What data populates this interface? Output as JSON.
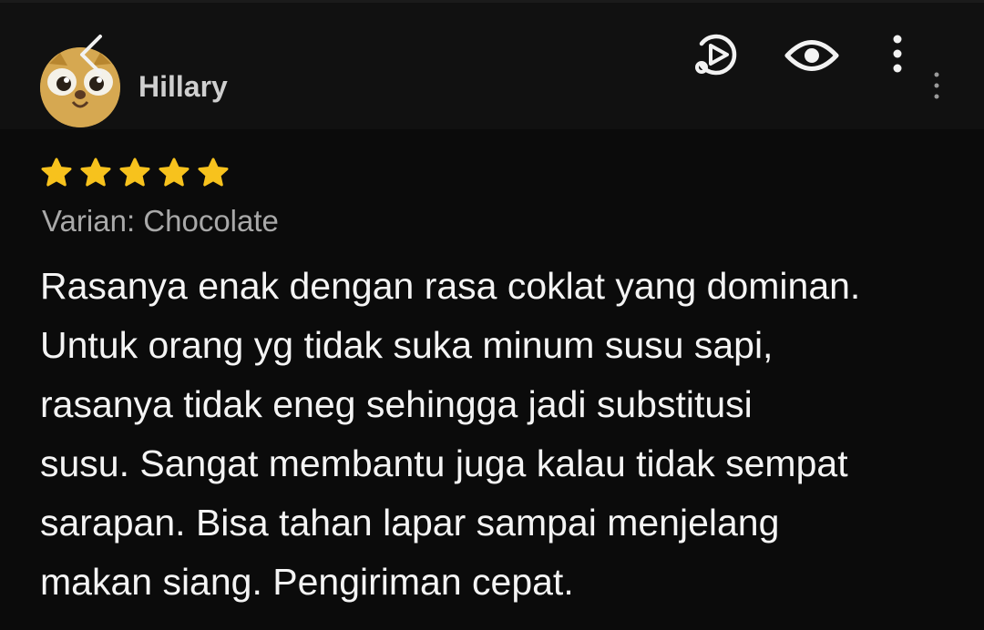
{
  "header": {
    "username": "Hillary",
    "icons": [
      "back-icon",
      "video-play-icon",
      "eye-icon",
      "more-vertical-icon"
    ]
  },
  "review": {
    "rating": 5,
    "rating_max": 5,
    "variant": "Varian: Chocolate",
    "lines": [
      "Rasanya enak dengan rasa coklat yang dominan.",
      "Untuk orang yg tidak suka minum susu sapi,",
      "rasanya tidak eneg sehingga jadi substitusi",
      "susu. Sangat membantu juga kalau tidak sempat",
      "sarapan. Bisa tahan lapar sampai menjelang",
      "makan siang. Pengiriman cepat."
    ]
  },
  "colors": {
    "background": "#0b0b0b",
    "header": "#111111",
    "star": "#f7c21d",
    "variant_text": "#a9a9a9"
  }
}
